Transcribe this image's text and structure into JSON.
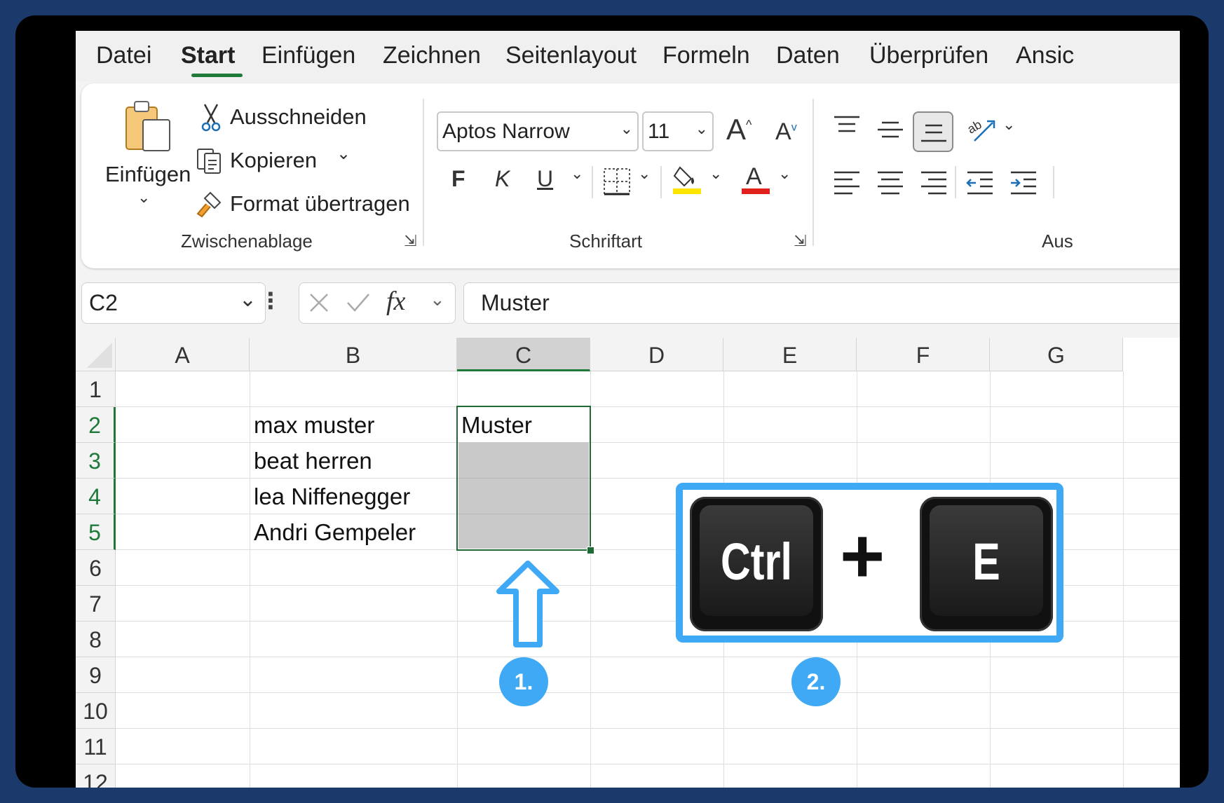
{
  "ribbon_tabs": [
    "Datei",
    "Start",
    "Einfügen",
    "Zeichnen",
    "Seitenlayout",
    "Formeln",
    "Daten",
    "Überprüfen",
    "Ansic"
  ],
  "active_tab": "Start",
  "clipboard": {
    "paste_label": "Einfügen",
    "cut_label": "Ausschneiden",
    "copy_label": "Kopieren",
    "format_painter_label": "Format übertragen",
    "group_label": "Zwischenablage"
  },
  "font": {
    "font_name": "Aptos Narrow",
    "font_size": "11",
    "bold_label": "F",
    "italic_label": "K",
    "underline_label": "U",
    "group_label": "Schriftart",
    "highlight_color": "#ffe500",
    "font_color": "#e0201b"
  },
  "alignment": {
    "group_label": "Aus"
  },
  "formula_bar": {
    "name_box": "C2",
    "fx_label": "fx",
    "content": "Muster"
  },
  "columns": [
    "A",
    "B",
    "C",
    "D",
    "E",
    "F",
    "G"
  ],
  "rows": [
    "1",
    "2",
    "3",
    "4",
    "5",
    "6",
    "7",
    "8",
    "9",
    "10",
    "11",
    "12"
  ],
  "cells": {
    "B2": "max muster",
    "B3": "beat herren",
    "B4": "lea Niffenegger",
    "B5": "Andri Gempeler",
    "C2": "Muster"
  },
  "overlay": {
    "key1": "Ctrl",
    "plus": "+",
    "key2": "E",
    "step1": "1.",
    "step2": "2.",
    "accent_color": "#3fa9f5"
  }
}
